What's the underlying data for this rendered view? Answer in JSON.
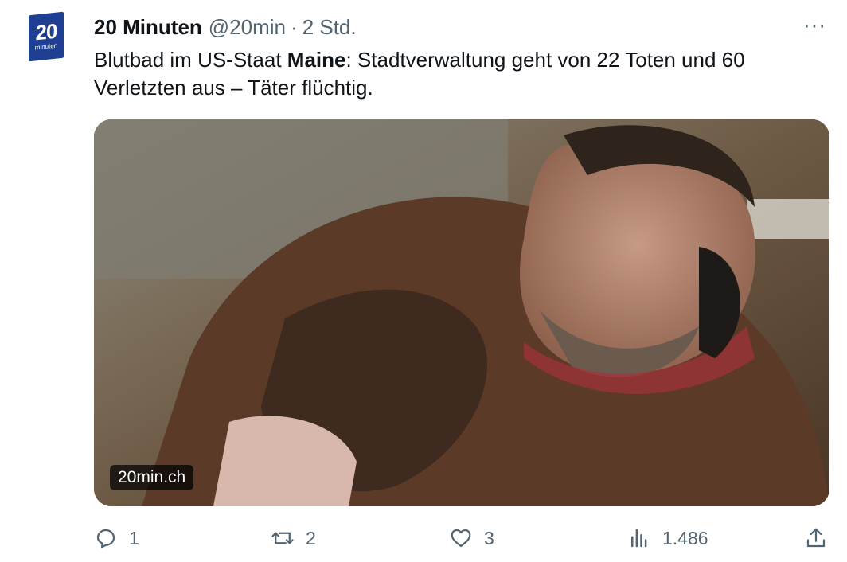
{
  "tweet": {
    "author_name": "20 Minuten",
    "handle": "@20min",
    "separator": "·",
    "time": "2 Std.",
    "more_label": "···",
    "text_part1": "Blutbad im US-Staat ",
    "text_bold": "Maine",
    "text_part2": ": Stadtverwaltung geht von 22 Toten und 60 Verletzten aus – Täter flüchtig.",
    "media_badge": "20min.ch",
    "avatar_text": "20",
    "avatar_subtext": "minuten"
  },
  "actions": {
    "replies": "1",
    "retweets": "2",
    "likes": "3",
    "views": "1.486"
  },
  "colors": {
    "brand": "#1f3f93",
    "secondary_text": "#536471",
    "primary_text": "#0f1419"
  }
}
